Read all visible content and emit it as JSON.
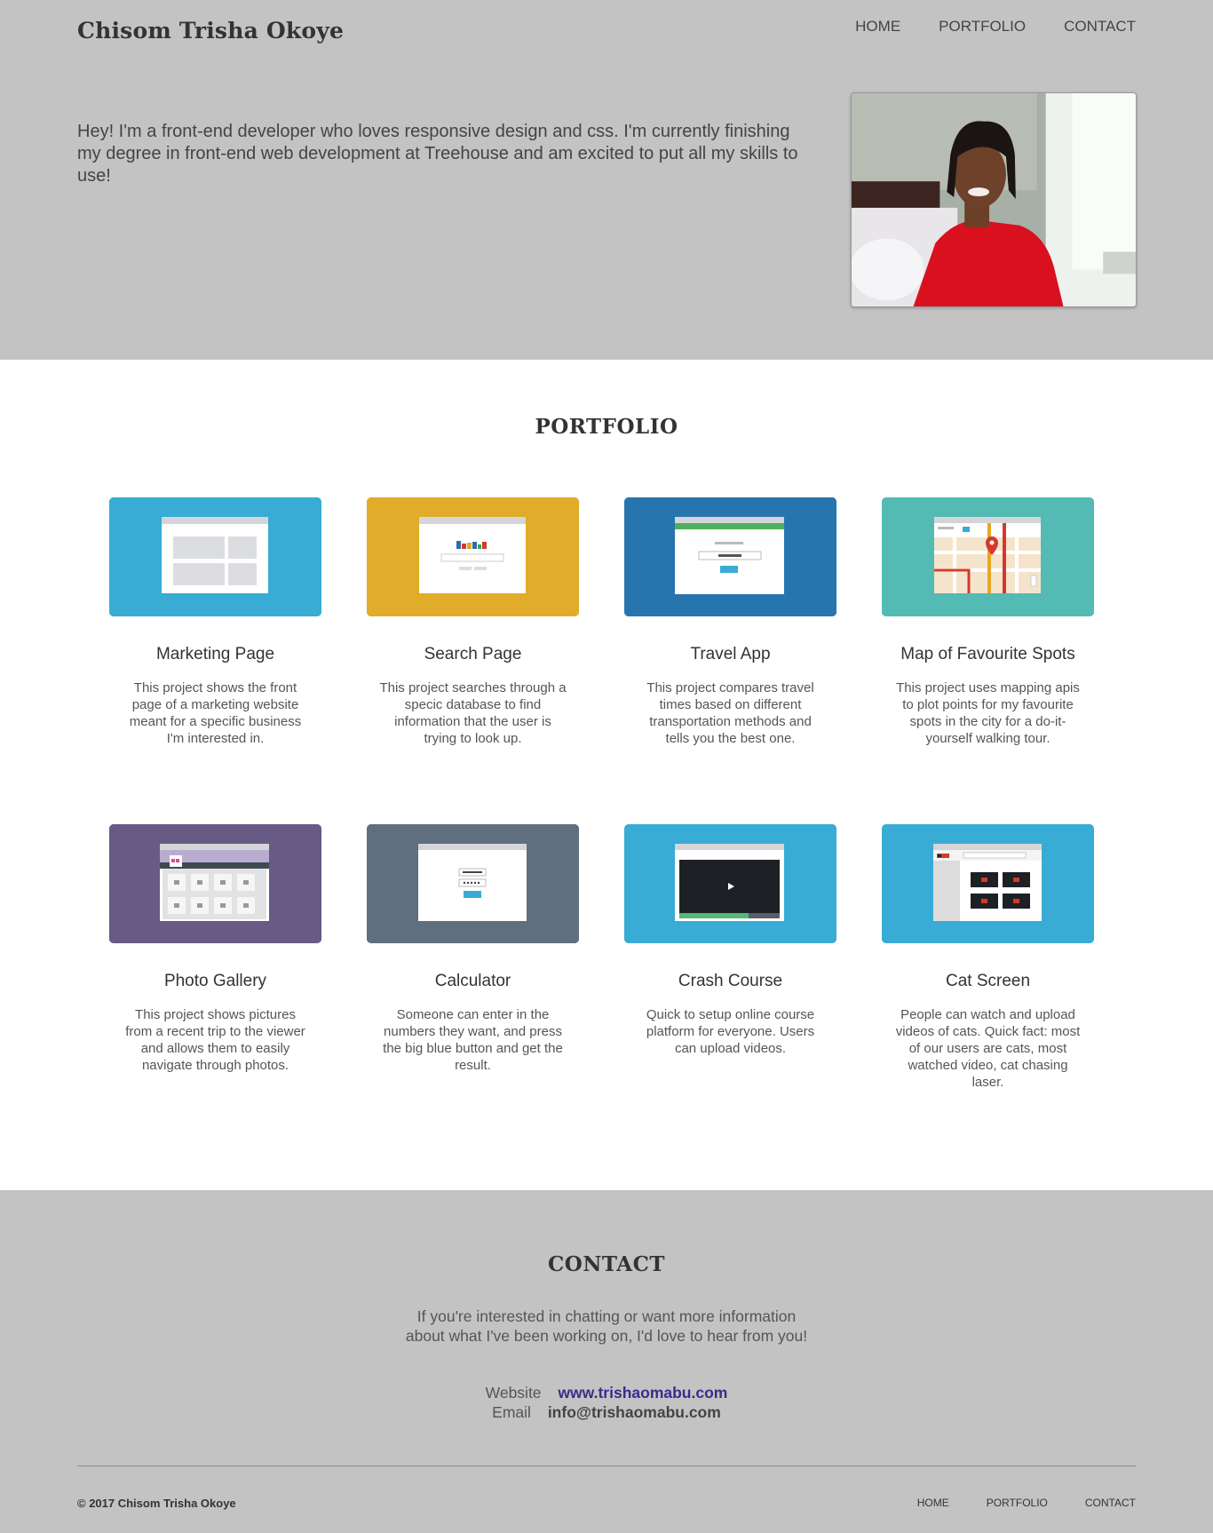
{
  "header": {
    "brand": "Chisom Trisha Okoye",
    "nav": [
      "HOME",
      "PORTFOLIO",
      "CONTACT"
    ],
    "intro": "Hey! I'm a front-end developer who loves responsive design and css. I'm currently finishing my degree in front-end web development at Treehouse and am excited to put all my skills to use!"
  },
  "portfolio": {
    "title": "PORTFOLIO",
    "projects": [
      {
        "title": "Marketing Page",
        "desc": "This project shows the front page of a marketing website meant for a specific business I'm interested in.",
        "color": "#38acd4",
        "icon": "marketing-page-icon"
      },
      {
        "title": "Search Page",
        "desc": "This project searches through a specic database to find information that the user is trying to look up.",
        "color": "#e1ac29",
        "icon": "search-page-icon"
      },
      {
        "title": "Travel App",
        "desc": "This project compares travel times based on different transportation methods and tells you the best one.",
        "color": "#2775ae",
        "icon": "travel-app-icon"
      },
      {
        "title": "Map of Favourite Spots",
        "desc": "This project uses mapping apis to plot points for my favourite spots in the city for a do-it-yourself walking tour.",
        "color": "#53bbb4",
        "icon": "map-icon"
      },
      {
        "title": "Photo Gallery",
        "desc": "This project shows pictures from a recent trip to the viewer and allows them to easily navigate through photos.",
        "color": "#675a85",
        "icon": "photo-gallery-icon"
      },
      {
        "title": "Calculator",
        "desc": "Someone can enter in the numbers they want, and press the big blue button and get the result.",
        "color": "#5f6f7d",
        "icon": "calculator-icon"
      },
      {
        "title": "Crash Course",
        "desc": "Quick to setup online course platform for everyone. Users can upload videos.",
        "color": "#38acd4",
        "icon": "video-player-icon"
      },
      {
        "title": "Cat Screen",
        "desc": "People can watch and upload videos of cats. Quick fact: most of our users are cats, most watched video, cat chasing laser.",
        "color": "#38acd4",
        "icon": "video-grid-icon"
      }
    ]
  },
  "contact": {
    "title": "CONTACT",
    "text": "If you're interested in chatting or want more information about what I've been working on, I'd love to hear from you!",
    "website_label": "Website",
    "website": "www.trishaomabu.com",
    "email_label": "Email",
    "email": "info@trishaomabu.com"
  },
  "footer": {
    "copyright": "© 2017 Chisom Trisha Okoye",
    "nav": [
      "HOME",
      "PORTFOLIO",
      "CONTACT"
    ]
  }
}
